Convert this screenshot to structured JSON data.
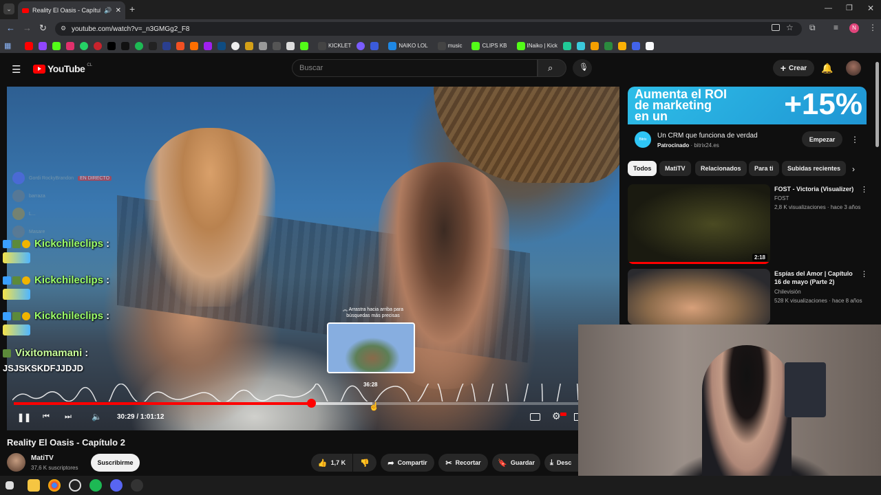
{
  "browser": {
    "tab_title": "Reality El Oasis - Capítulo 2",
    "url": "youtube.com/watch?v=_n3GMGg2_F8",
    "bookmarks": [
      {
        "label": "KICKLET",
        "icon": "kick-icon"
      },
      {
        "label": "NAIKO LOL",
        "icon": "naiko-icon"
      },
      {
        "label": "music",
        "icon": "music-icon"
      },
      {
        "label": "CLIPS KB",
        "icon": "clips-icon"
      },
      {
        "label": "INaiko | Kick",
        "icon": "kick-icon"
      }
    ]
  },
  "youtube": {
    "logo_text": "YouTube",
    "country_code": "CL",
    "search_placeholder": "Buscar",
    "create_label": "Crear"
  },
  "player": {
    "scrub_hint": "Arrastra hacia arriba para búsquedas más precisas",
    "hover_time": "36:28",
    "time_display": "30:29 / 1:01:12",
    "played_fraction": 0.527,
    "hover_fraction": 0.635
  },
  "overlay_chat": {
    "ghost_messages": [
      {
        "name": "Gordi RockyBrandon",
        "tag": "EN DIRECTO"
      },
      {
        "name": "barraza"
      },
      {
        "name": "L..."
      },
      {
        "name": "Masare"
      }
    ],
    "messages": [
      {
        "user": "Kickchileclips",
        "text": ""
      },
      {
        "user": "Kickchileclips",
        "text": ""
      },
      {
        "user": "Kickchileclips",
        "text": ""
      },
      {
        "user": "Vixitomamani",
        "text": "JSJSKSKDFJJDJD"
      }
    ]
  },
  "video": {
    "title": "Reality El Oasis - Capítulo 2",
    "channel": "MatiTV",
    "subscribers": "37,6 K suscriptores",
    "subscribe_label": "Suscribirme",
    "likes": "1,7 K",
    "share_label": "Compartir",
    "clip_label": "Recortar",
    "save_label": "Guardar",
    "download_label": "Desc"
  },
  "ad": {
    "banner_line1": "Aumenta el ROI",
    "banner_line2": "de marketing",
    "banner_line3": "en un",
    "banner_pct": "+15%",
    "title": "Un CRM que funciona de verdad",
    "sponsored": "Patrocinado",
    "domain": "bitrix24.es",
    "cta": "Empezar"
  },
  "chips": [
    "Todos",
    "MatiTV",
    "Relacionados",
    "Para ti",
    "Subidas recientes"
  ],
  "related": [
    {
      "title": "FOST - Victoria (Visualizer)",
      "channel": "FOST",
      "meta": "2,8 K visualizaciones · hace 3 años",
      "duration": "2:18"
    },
    {
      "title": "Espías del Amor | Capítulo 16 de mayo (Parte 2)",
      "channel": "Chilevisión",
      "meta": "528 K visualizaciones · hace 8 años",
      "duration": ""
    }
  ]
}
